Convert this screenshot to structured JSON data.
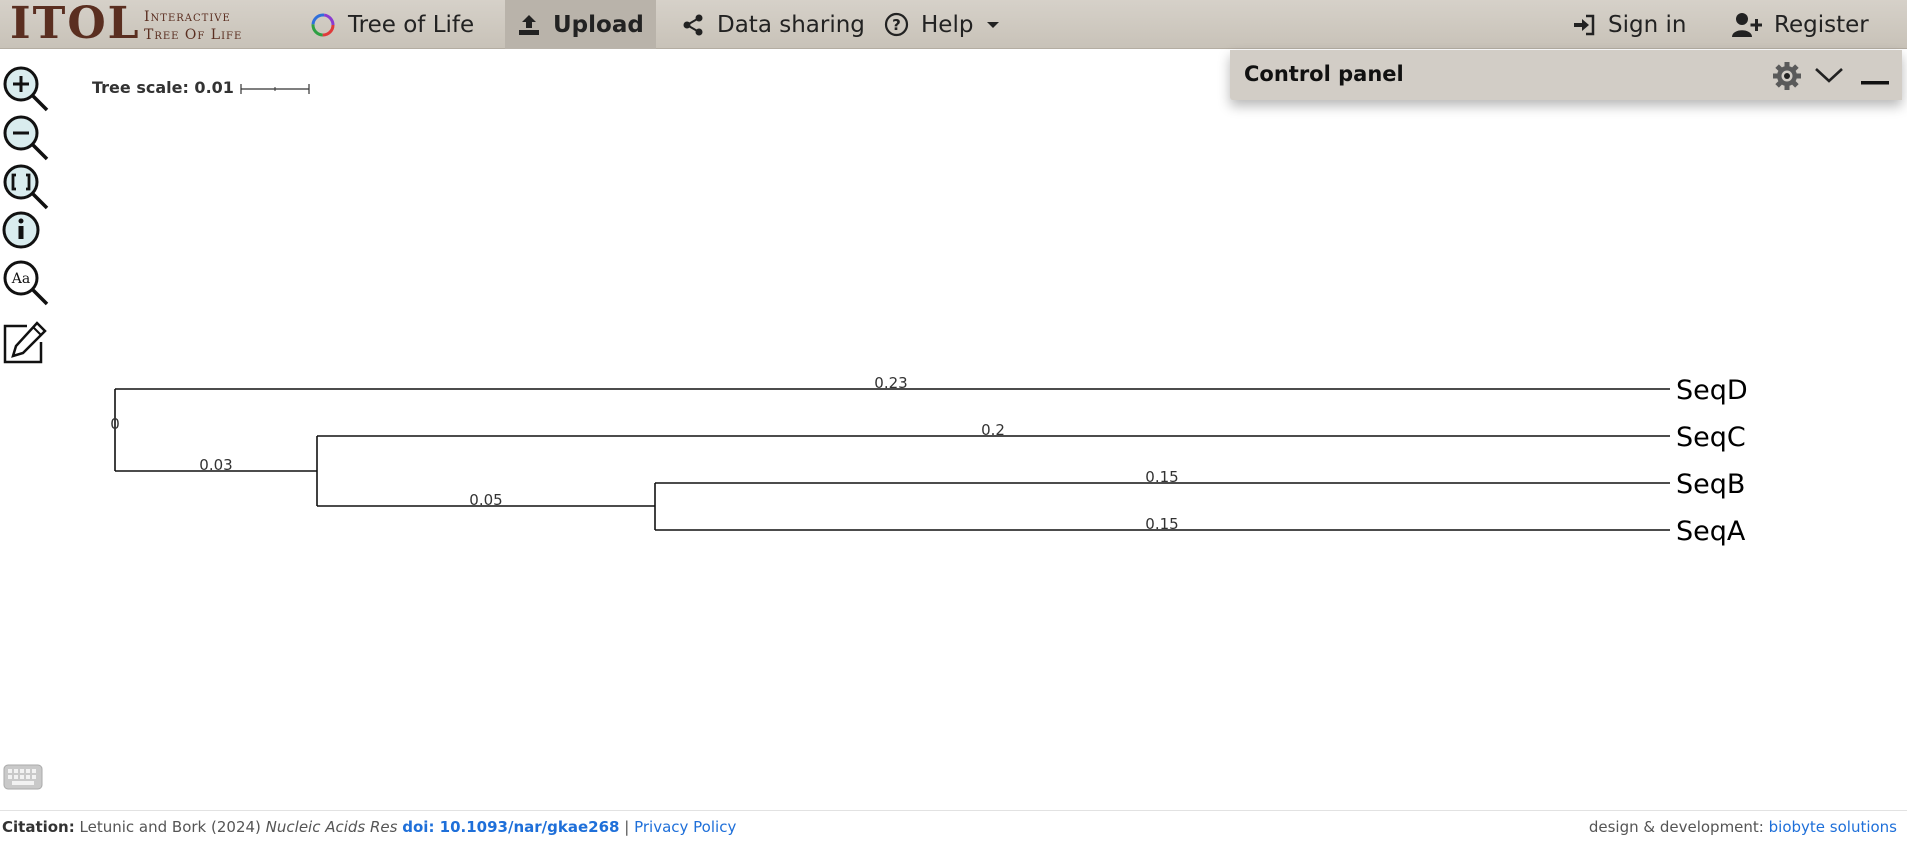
{
  "app": {
    "logo_big": "ITOL",
    "logo_small_line1": "Interactive",
    "logo_small_line2": "Tree Of Life"
  },
  "nav": {
    "tree_of_life": "Tree of Life",
    "upload": "Upload",
    "data_sharing": "Data sharing",
    "help": "Help",
    "sign_in": "Sign in",
    "register": "Register"
  },
  "toolbar": {
    "icons": [
      "zoom-in-icon",
      "zoom-out-icon",
      "zoom-fit-icon",
      "info-icon",
      "font-zoom-icon",
      "edit-icon"
    ]
  },
  "tree_scale": {
    "label": "Tree scale: 0.01"
  },
  "tree": {
    "leaves": [
      {
        "label": "SeqD",
        "branch_length": "0.23"
      },
      {
        "label": "SeqC",
        "branch_length": "0.2"
      },
      {
        "label": "SeqB",
        "branch_length": "0.15"
      },
      {
        "label": "SeqA",
        "branch_length": "0.15"
      }
    ],
    "internal_branches": [
      {
        "label": "0"
      },
      {
        "label": "0.03"
      },
      {
        "label": "0.05"
      }
    ]
  },
  "control_panel": {
    "title": "Control panel"
  },
  "footer": {
    "citation_label": "Citation:",
    "citation_authors": "Letunic and Bork (2024)",
    "citation_journal": "Nucleic Acids Res",
    "doi": "doi: 10.1093/nar/gkae268",
    "separator": "|",
    "privacy": "Privacy Policy",
    "credit_text": "design & development:",
    "credit_link": "biobyte solutions"
  },
  "colors": {
    "nav_bg": "#d0cac1",
    "logo": "#5a2e20",
    "link": "#1e6fd9",
    "tool_fill": "#d9ecee"
  }
}
